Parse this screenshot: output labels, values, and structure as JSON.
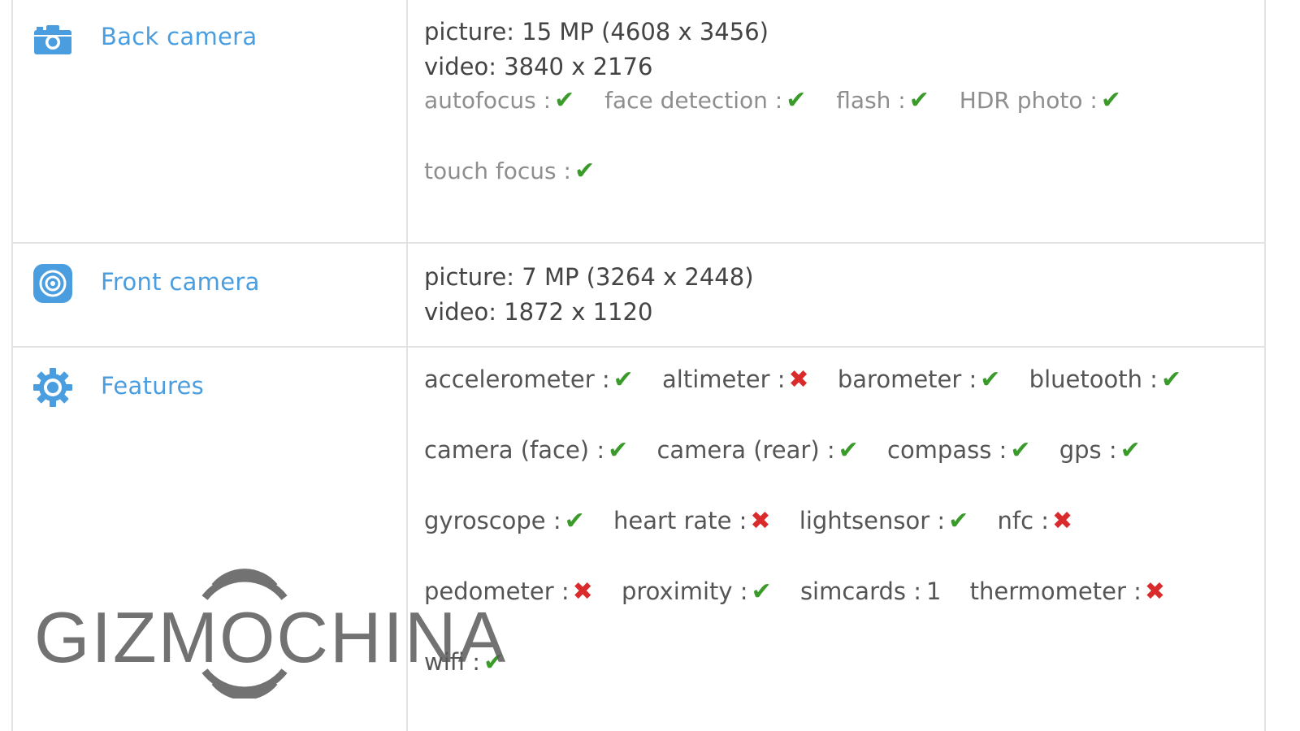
{
  "rows": {
    "back_camera": {
      "label": "Back camera",
      "icon": "camera-icon",
      "picture": "picture: 15 MP (4608 x 3456)",
      "video": "video: 3840 x 2176",
      "flags": [
        {
          "name": "autofocus :",
          "value": "yes"
        },
        {
          "name": "face detection :",
          "value": "yes"
        },
        {
          "name": "flash :",
          "value": "yes"
        },
        {
          "name": "HDR photo :",
          "value": "yes"
        },
        {
          "name": "touch focus :",
          "value": "yes"
        }
      ]
    },
    "front_camera": {
      "label": "Front camera",
      "icon": "front-camera-icon",
      "picture": "picture: 7 MP (3264 x 2448)",
      "video": "video: 1872 x 1120"
    },
    "features": {
      "label": "Features",
      "icon": "gear-icon",
      "items": [
        {
          "name": "accelerometer :",
          "value": "yes"
        },
        {
          "name": "altimeter :",
          "value": "no"
        },
        {
          "name": "barometer :",
          "value": "yes"
        },
        {
          "name": "bluetooth :",
          "value": "yes"
        },
        {
          "name": "camera (face) :",
          "value": "yes"
        },
        {
          "name": "camera (rear) :",
          "value": "yes"
        },
        {
          "name": "compass :",
          "value": "yes"
        },
        {
          "name": "gps :",
          "value": "yes"
        },
        {
          "name": "gyroscope :",
          "value": "yes"
        },
        {
          "name": "heart rate :",
          "value": "no"
        },
        {
          "name": "lightsensor :",
          "value": "yes"
        },
        {
          "name": "nfc :",
          "value": "no"
        },
        {
          "name": "pedometer :",
          "value": "no"
        },
        {
          "name": "proximity :",
          "value": "yes"
        },
        {
          "name": "simcards :",
          "value": "1"
        },
        {
          "name": "thermometer :",
          "value": "no"
        },
        {
          "name": "wifi :",
          "value": "yes"
        }
      ]
    }
  },
  "marks": {
    "yes": "✔",
    "no": "✖"
  },
  "colors": {
    "label": "#4a9ee0",
    "yes": "#3a9a2a",
    "no": "#d92b2b"
  },
  "watermark": {
    "text": "GIZMOCHINA"
  }
}
